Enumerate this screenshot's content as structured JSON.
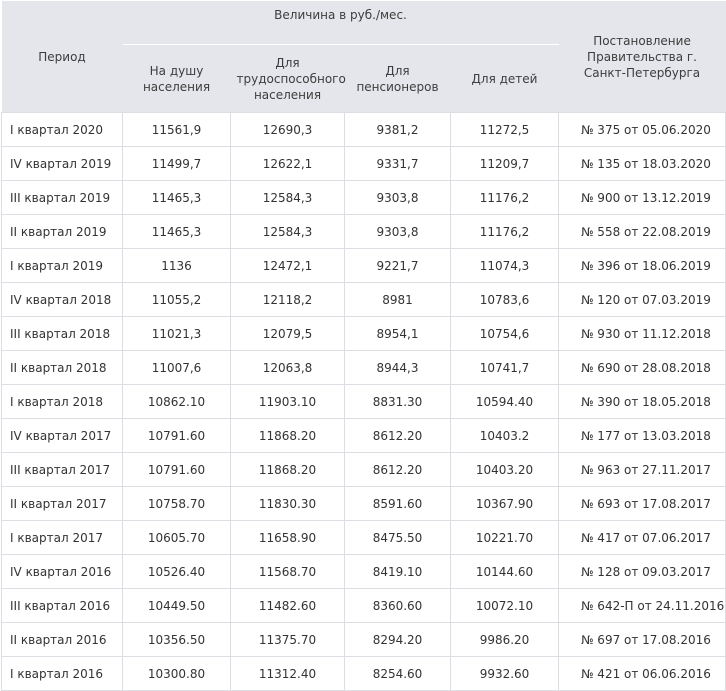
{
  "table": {
    "header": {
      "period": "Период",
      "value_group": "Величина в руб./мес.",
      "per_capita": "На душу населения",
      "able_bodied": "Для трудоспособного населения",
      "pensioners": "Для пенсионеров",
      "children": "Для детей",
      "decree": "Постановление Правительства г. Санкт-Петербурга"
    },
    "rows": [
      {
        "period": "I квартал 2020",
        "per_capita": "11561,9",
        "able_bodied": "12690,3",
        "pensioners": "9381,2",
        "children": "11272,5",
        "decree": "№ 375 от 05.06.2020"
      },
      {
        "period": "IV квартал 2019",
        "per_capita": "11499,7",
        "able_bodied": "12622,1",
        "pensioners": "9331,7",
        "children": "11209,7",
        "decree": "№ 135 от 18.03.2020"
      },
      {
        "period": "III квартал 2019",
        "per_capita": "11465,3",
        "able_bodied": "12584,3",
        "pensioners": "9303,8",
        "children": "11176,2",
        "decree": "№ 900 от 13.12.2019"
      },
      {
        "period": "II квартал 2019",
        "per_capita": "11465,3",
        "able_bodied": "12584,3",
        "pensioners": "9303,8",
        "children": "11176,2",
        "decree": "№ 558 от 22.08.2019"
      },
      {
        "period": "I квартал 2019",
        "per_capita": "1136",
        "able_bodied": "12472,1",
        "pensioners": "9221,7",
        "children": "11074,3",
        "decree": "№ 396 от 18.06.2019"
      },
      {
        "period": "IV квартал 2018",
        "per_capita": "11055,2",
        "able_bodied": "12118,2",
        "pensioners": "8981",
        "children": "10783,6",
        "decree": "№ 120 от 07.03.2019"
      },
      {
        "period": "III квартал 2018",
        "per_capita": "11021,3",
        "able_bodied": "12079,5",
        "pensioners": "8954,1",
        "children": "10754,6",
        "decree": "№ 930 от 11.12.2018"
      },
      {
        "period": "II квартал 2018",
        "per_capita": "11007,6",
        "able_bodied": "12063,8",
        "pensioners": "8944,3",
        "children": "10741,7",
        "decree": "№ 690 от 28.08.2018"
      },
      {
        "period": "I квартал 2018",
        "per_capita": "10862.10",
        "able_bodied": "11903.10",
        "pensioners": "8831.30",
        "children": "10594.40",
        "decree": "№ 390 от 18.05.2018"
      },
      {
        "period": "IV квартал 2017",
        "per_capita": "10791.60",
        "able_bodied": "11868.20",
        "pensioners": "8612.20",
        "children": "10403.2",
        "decree": "№ 177 от 13.03.2018"
      },
      {
        "period": "III квартал 2017",
        "per_capita": "10791.60",
        "able_bodied": "11868.20",
        "pensioners": "8612.20",
        "children": "10403.20",
        "decree": "№ 963 от 27.11.2017"
      },
      {
        "period": "II квартал 2017",
        "per_capita": "10758.70",
        "able_bodied": "11830.30",
        "pensioners": "8591.60",
        "children": "10367.90",
        "decree": "№ 693 от 17.08.2017"
      },
      {
        "period": "I квартал 2017",
        "per_capita": "10605.70",
        "able_bodied": "11658.90",
        "pensioners": "8475.50",
        "children": "10221.70",
        "decree": "№ 417 от 07.06.2017"
      },
      {
        "period": "IV квартал 2016",
        "per_capita": "10526.40",
        "able_bodied": "11568.70",
        "pensioners": "8419.10",
        "children": "10144.60",
        "decree": "№ 128 от 09.03.2017"
      },
      {
        "period": "III квартал 2016",
        "per_capita": "10449.50",
        "able_bodied": "11482.60",
        "pensioners": "8360.60",
        "children": "10072.10",
        "decree": "№ 642-П от 24.11.2016"
      },
      {
        "period": "II квартал 2016",
        "per_capita": "10356.50",
        "able_bodied": "11375.70",
        "pensioners": "8294.20",
        "children": "9986.20",
        "decree": "№ 697 от 17.08.2016"
      },
      {
        "period": "I квартал 2016",
        "per_capita": "10300.80",
        "able_bodied": "11312.40",
        "pensioners": "8254.60",
        "children": "9932.60",
        "decree": "№ 421 от 06.06.2016"
      }
    ]
  }
}
